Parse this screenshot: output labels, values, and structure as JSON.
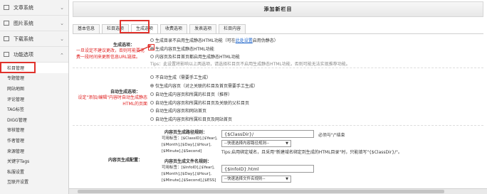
{
  "sidebar": {
    "groups": [
      {
        "label": "文章系统",
        "icon": "article-icon",
        "open": false
      },
      {
        "label": "图片系统",
        "icon": "image-icon",
        "open": false
      },
      {
        "label": "下载系统",
        "icon": "download-icon",
        "open": false
      },
      {
        "label": "功能选项",
        "icon": "monitor-icon",
        "open": true
      }
    ],
    "items": [
      "栏目管理",
      "专题管理",
      "网站地图",
      "评论管理",
      "TAG标签",
      "DIGG管理",
      "审核管理",
      "作者管理",
      "来源管理",
      "关键字Tags",
      "私服设置",
      "互联开设置"
    ],
    "active_item": "栏目管理"
  },
  "page_title": "添加新栏目",
  "tabs": [
    {
      "label": "基本信息",
      "active": false
    },
    {
      "label": "栏目选项",
      "active": false
    },
    {
      "label": "生成选项",
      "active": true
    },
    {
      "label": "收费选项",
      "active": false
    },
    {
      "label": "发表选项",
      "active": false
    },
    {
      "label": "栏目内容",
      "active": false
    }
  ],
  "gen_section": {
    "title": "生成选项：",
    "note": "一旦设定不建议更改，否则可能要花费一段时间来更新信息URL链接。",
    "options": [
      {
        "text": "生成目录不启用生成静态HTML功能（可在",
        "link": "此处设置",
        "suffix": "启用伪静态）",
        "selected": false
      },
      {
        "text": "生成内容页生成静态HTML功能",
        "selected": true
      },
      {
        "text": "内容页及栏目首页都启用生成静态HTML功能",
        "selected": false
      }
    ],
    "tip": "Tips：此设置将影响以上两选项，请选择栏目页不启用生成静态HTML功能，否则可能无法实现推荐功能。"
  },
  "auto_section": {
    "title": "自动生成选项：",
    "note": "设定\"添加/编辑\"内容时自动生成静态HTML的页面",
    "options": [
      {
        "text": "不自动生成（需要手工生成）",
        "selected": false
      },
      {
        "text": "仅生成内容页（对之关联的栏目及首页需要手工生成）",
        "selected": true
      },
      {
        "text": "自动生成内容页和所属的栏目页（推荐）",
        "selected": false
      },
      {
        "text": "自动生成内容页和所属的栏目页及关联的父栏目页",
        "selected": false
      },
      {
        "text": "自动生成内容页和网站首页",
        "selected": false
      },
      {
        "text": "自动生成内容页和所属栏目页及网站首页",
        "selected": false
      }
    ]
  },
  "config_section": {
    "title": "内容页生成配置：",
    "path_rule_label": "内容页生成路径规则：",
    "path_vars": [
      "可用标签：[$ClassID],[$Year],",
      "[$Month],[$Day],[$Hour],",
      "[$Minute],[$Second]"
    ],
    "path_value": "{$ClassDir}/",
    "path_suffix": "必须与\"/\"结束",
    "path_select": "--快速选择内容路径规则--",
    "path_tip": "Tips:启用绑定域名，且采用\"新建域名绑定到生成的HTML目录\"时，只能填写\"{$ClassDir}/\"。",
    "file_rule_label": "内容页生成文件名规则：",
    "file_vars": [
      "可用标签：[$InfoID],[$Year],",
      "[$Month],[$Day],[$Hour],",
      "[$Minute],[$Second],[$ESS]"
    ],
    "file_value": "{$InfoID}.html",
    "file_select": "--快速选择文件名规则--"
  }
}
